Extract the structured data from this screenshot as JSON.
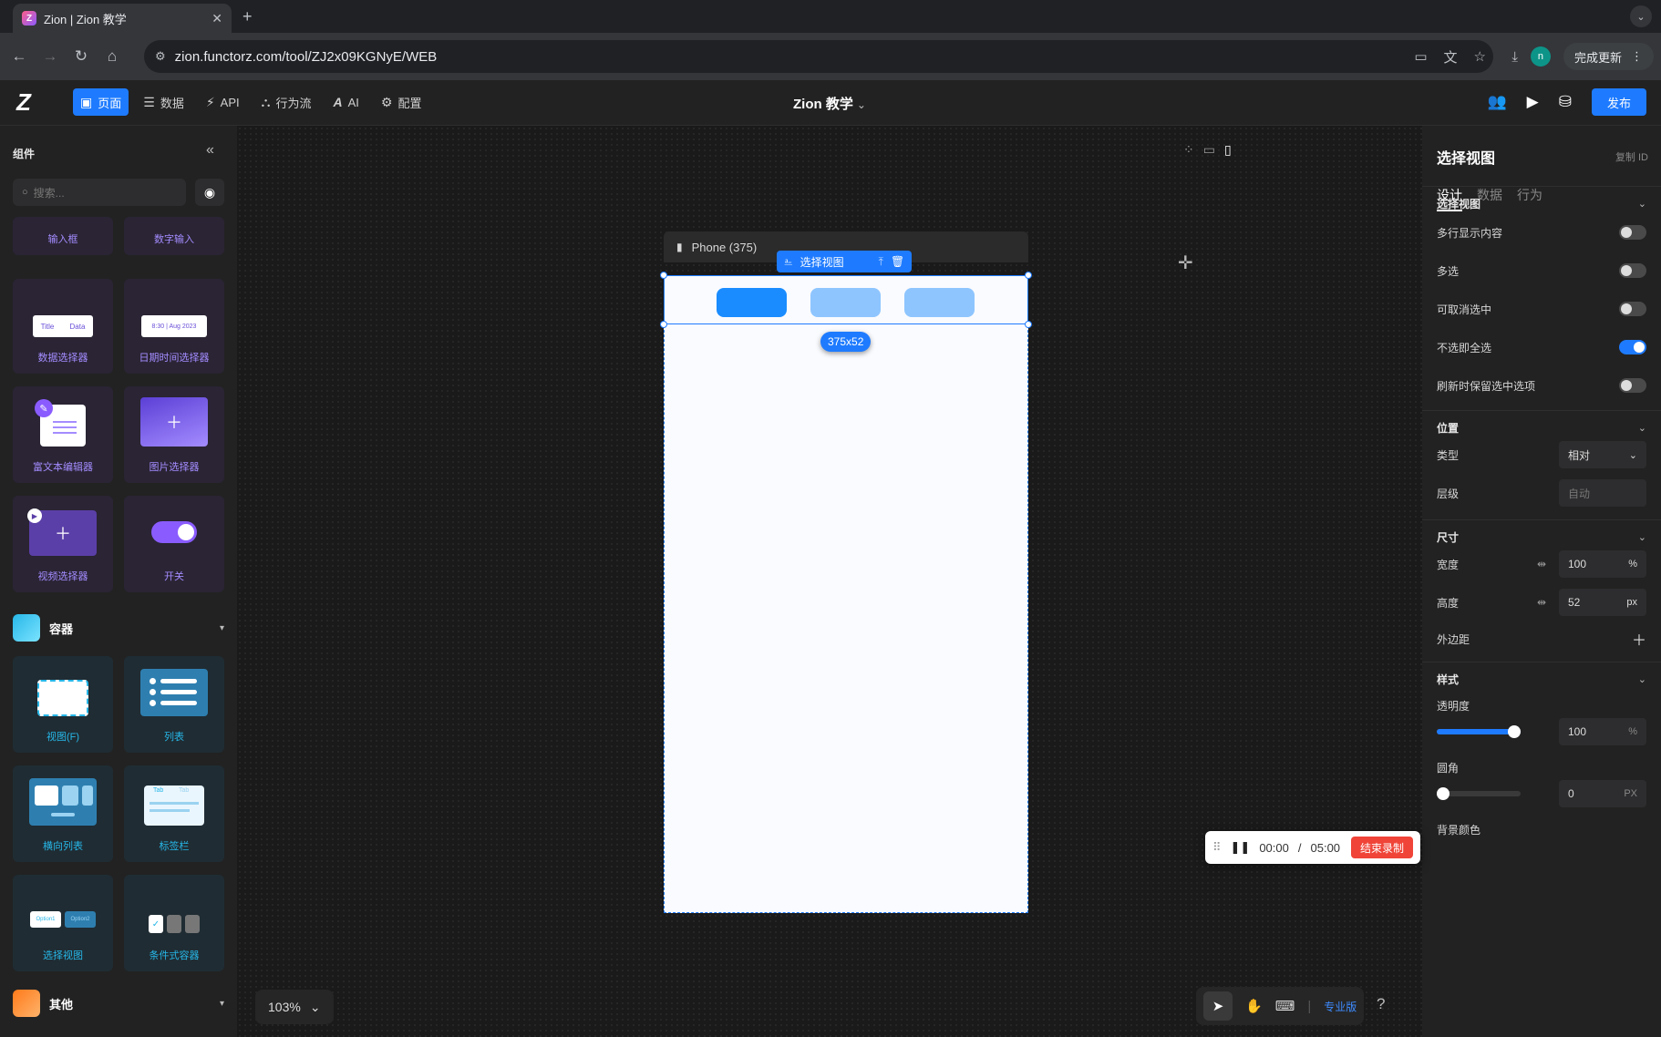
{
  "browser": {
    "tab_title": "Zion | Zion 教学",
    "tab_favicon_letter": "Z",
    "new_tab": "+",
    "url": "zion.functorz.com/tool/ZJ2x09KGNyE/WEB",
    "profile_initial": "n",
    "update_label": "完成更新"
  },
  "app": {
    "logo": "Z",
    "nav": [
      {
        "label": "页面",
        "icon": "page-icon"
      },
      {
        "label": "数据",
        "icon": "database-icon"
      },
      {
        "label": "API",
        "icon": "api-icon"
      },
      {
        "label": "行为流",
        "icon": "flow-icon"
      },
      {
        "label": "AI",
        "icon": "ai-icon"
      },
      {
        "label": "配置",
        "icon": "settings-icon"
      }
    ],
    "project_title": "Zion 教学",
    "publish_label": "发布"
  },
  "left_panel": {
    "title": "组件",
    "search_placeholder": "搜索...",
    "cards_top": [
      "输入框",
      "数字输入"
    ],
    "cards_a": [
      "数据选择器",
      "日期时间选择器",
      "富文本编辑器",
      "图片选择器",
      "视频选择器",
      "开关"
    ],
    "thumb_texts": {
      "data_title": "Title",
      "data_value": "Data",
      "date_value": "8:30 | Aug 2023"
    },
    "section_container": "容器",
    "cards_b": [
      "视图(F)",
      "列表",
      "横向列表",
      "标签栏",
      "选择视图",
      "条件式容器"
    ],
    "tab_thumb": {
      "tab1": "Tab",
      "tab2": "Tab"
    },
    "option_thumb": {
      "opt1": "Option1",
      "opt2": "Option2"
    },
    "section_other": "其他"
  },
  "canvas": {
    "device_label": "Phone (375)",
    "selection_label": "选择视图",
    "size_badge": "375x52",
    "zoom": "103%",
    "pro_label": "专业版",
    "help": "?",
    "option_colors": [
      "#1a8cff",
      "#8ec5ff",
      "#8ec5ff"
    ]
  },
  "right_panel": {
    "title": "选择视图",
    "copy_id": "复制 ID",
    "tabs": [
      "设计",
      "数据",
      "行为"
    ],
    "sec_select": "选择视图",
    "toggles": [
      {
        "label": "多行显示内容",
        "on": false
      },
      {
        "label": "多选",
        "on": false
      },
      {
        "label": "可取消选中",
        "on": false
      },
      {
        "label": "不选即全选",
        "on": true
      },
      {
        "label": "刷新时保留选中选项",
        "on": false
      }
    ],
    "sec_position": "位置",
    "type_label": "类型",
    "type_value": "相对",
    "level_label": "层级",
    "level_placeholder": "自动",
    "sec_size": "尺寸",
    "width_label": "宽度",
    "width_value": "100",
    "width_unit": "%",
    "height_label": "高度",
    "height_value": "52",
    "height_unit": "px",
    "margin_label": "外边距",
    "sec_style": "样式",
    "opacity_label": "透明度",
    "opacity_value": "100",
    "opacity_unit": "%",
    "radius_label": "圆角",
    "radius_value": "0",
    "radius_unit": "PX",
    "bg_label": "背景颜色",
    "opacity_level": 1.0,
    "radius_level": 0
  },
  "recording": {
    "elapsed": "00:00",
    "separator": "/",
    "total": "05:00",
    "stop_label": "结束录制"
  }
}
